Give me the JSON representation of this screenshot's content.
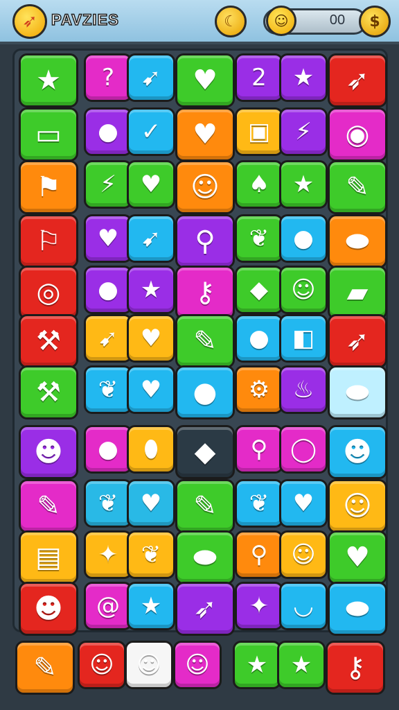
{
  "header": {
    "title": "PAVZIES",
    "score": "00",
    "icons": [
      "rocket-logo-icon",
      "banana-icon",
      "smiley-icon",
      "coin-icon"
    ]
  },
  "colors": {
    "green": "#3ecb2a",
    "magenta": "#e42bc8",
    "cyan": "#22b8f0",
    "purple": "#9a2ee6",
    "red": "#e4261f",
    "orange": "#ff8a0d",
    "yellow": "#ffb915",
    "teal": "#29b9e6",
    "lightcyan": "#bff0ff",
    "darkslate": "#2b3a45",
    "white": "#f6f6f6"
  },
  "grid": {
    "rows": [
      [
        {
          "name": "star-wand-icon",
          "glyph": "★",
          "color": "green"
        },
        {
          "name": "question-icon",
          "glyph": "?",
          "color": "magenta"
        },
        {
          "name": "boomerang-icon",
          "glyph": "➹",
          "color": "cyan"
        },
        {
          "name": "heart-icon",
          "glyph": "♥",
          "color": "green"
        },
        {
          "name": "number-two-icon",
          "glyph": "2",
          "color": "purple"
        },
        {
          "name": "star-icon",
          "glyph": "★",
          "color": "purple"
        },
        {
          "name": "rocket-icon",
          "glyph": "➶",
          "color": "red"
        }
      ],
      [
        {
          "name": "scroll-banner-icon",
          "glyph": "▭",
          "color": "green"
        },
        {
          "name": "balloon-icon",
          "glyph": "●",
          "color": "purple"
        },
        {
          "name": "chili-icon",
          "glyph": "✓",
          "color": "cyan"
        },
        {
          "name": "cloud-heart-icon",
          "glyph": "♥",
          "color": "orange"
        },
        {
          "name": "treasure-box-icon",
          "glyph": "▣",
          "color": "yellow"
        },
        {
          "name": "lightning-gem-icon",
          "glyph": "⚡",
          "color": "purple"
        },
        {
          "name": "magnifier-icon",
          "glyph": "◉",
          "color": "magenta"
        }
      ],
      [
        {
          "name": "flag-icon",
          "glyph": "⚑",
          "color": "orange"
        },
        {
          "name": "lightning-icon",
          "glyph": "⚡",
          "color": "green"
        },
        {
          "name": "heart-icon",
          "glyph": "♥",
          "color": "green"
        },
        {
          "name": "cat-face-icon",
          "glyph": "☺",
          "color": "orange"
        },
        {
          "name": "leaf-icon",
          "glyph": "♠",
          "color": "green"
        },
        {
          "name": "star-icon",
          "glyph": "★",
          "color": "green"
        },
        {
          "name": "crayon-icon",
          "glyph": "✎",
          "color": "green"
        }
      ],
      [
        {
          "name": "banner-sign-icon",
          "glyph": "⚐",
          "color": "red"
        },
        {
          "name": "heart-icon",
          "glyph": "♥",
          "color": "purple"
        },
        {
          "name": "boomerang-icon",
          "glyph": "➹",
          "color": "cyan"
        },
        {
          "name": "magnifier-icon",
          "glyph": "⚲",
          "color": "purple"
        },
        {
          "name": "leaf-icon",
          "glyph": "❦",
          "color": "green"
        },
        {
          "name": "apple-icon",
          "glyph": "●",
          "color": "cyan"
        },
        {
          "name": "bread-icon",
          "glyph": "⬬",
          "color": "orange"
        }
      ],
      [
        {
          "name": "spiral-icon",
          "glyph": "◎",
          "color": "red"
        },
        {
          "name": "bomb-icon",
          "glyph": "●",
          "color": "purple"
        },
        {
          "name": "star-icon",
          "glyph": "★",
          "color": "purple"
        },
        {
          "name": "key-icon",
          "glyph": "⚷",
          "color": "magenta"
        },
        {
          "name": "gem-icon",
          "glyph": "◆",
          "color": "green"
        },
        {
          "name": "ghost-face-icon",
          "glyph": "☺",
          "color": "green"
        },
        {
          "name": "eraser-icon",
          "glyph": "▰",
          "color": "green"
        }
      ],
      [
        {
          "name": "axe-icon",
          "glyph": "⚒",
          "color": "red"
        },
        {
          "name": "boomerang-icon",
          "glyph": "➹",
          "color": "yellow"
        },
        {
          "name": "heart-icon",
          "glyph": "♥",
          "color": "yellow"
        },
        {
          "name": "pencil-icon",
          "glyph": "✎",
          "color": "green"
        },
        {
          "name": "cookie-icon",
          "glyph": "●",
          "color": "cyan"
        },
        {
          "name": "puzzle-icon",
          "glyph": "◧",
          "color": "cyan"
        },
        {
          "name": "rocket-pop-icon",
          "glyph": "➶",
          "color": "red"
        }
      ],
      [
        {
          "name": "hammer-icon",
          "glyph": "⚒",
          "color": "green"
        },
        {
          "name": "leaf-icon",
          "glyph": "❦",
          "color": "cyan"
        },
        {
          "name": "heart-icon",
          "glyph": "♥",
          "color": "cyan"
        },
        {
          "name": "lime-icon",
          "glyph": "●",
          "color": "cyan"
        },
        {
          "name": "robot-icon",
          "glyph": "⚙",
          "color": "orange"
        },
        {
          "name": "bell-pepper-icon",
          "glyph": "♨",
          "color": "purple"
        },
        {
          "name": "pastry-icon",
          "glyph": "⬬",
          "color": "lightcyan"
        }
      ],
      [
        {
          "name": "monster-face-icon",
          "glyph": "☻",
          "color": "purple"
        },
        {
          "name": "egg-icon",
          "glyph": "●",
          "color": "magenta"
        },
        {
          "name": "bean-icon",
          "glyph": "⬮",
          "color": "yellow"
        },
        {
          "name": "crystal-icon",
          "glyph": "◆",
          "color": "darkslate"
        },
        {
          "name": "magnifier-icon",
          "glyph": "⚲",
          "color": "magenta"
        },
        {
          "name": "ring-icon",
          "glyph": "◯",
          "color": "magenta"
        },
        {
          "name": "red-face-icon",
          "glyph": "☻",
          "color": "cyan"
        }
      ],
      [
        {
          "name": "pen-paper-icon",
          "glyph": "✎",
          "color": "magenta"
        },
        {
          "name": "leaf-icon",
          "glyph": "❦",
          "color": "teal"
        },
        {
          "name": "heart-icon",
          "glyph": "♥",
          "color": "teal"
        },
        {
          "name": "pencil-icon",
          "glyph": "✎",
          "color": "green"
        },
        {
          "name": "leaf-icon",
          "glyph": "❦",
          "color": "cyan"
        },
        {
          "name": "heart-icon",
          "glyph": "♥",
          "color": "cyan"
        },
        {
          "name": "tiger-face-icon",
          "glyph": "☺",
          "color": "yellow"
        }
      ],
      [
        {
          "name": "scroll-robot-icon",
          "glyph": "▤",
          "color": "yellow"
        },
        {
          "name": "star-icon",
          "glyph": "✦",
          "color": "yellow"
        },
        {
          "name": "leaf-icon",
          "glyph": "❦",
          "color": "yellow"
        },
        {
          "name": "lemon-icon",
          "glyph": "⬬",
          "color": "green"
        },
        {
          "name": "magnifier-icon",
          "glyph": "⚲",
          "color": "orange"
        },
        {
          "name": "smile-face-icon",
          "glyph": "☺",
          "color": "yellow"
        },
        {
          "name": "heart-icon",
          "glyph": "♥",
          "color": "green"
        }
      ],
      [
        {
          "name": "pink-monster-icon",
          "glyph": "☻",
          "color": "red"
        },
        {
          "name": "snail-icon",
          "glyph": "@",
          "color": "magenta"
        },
        {
          "name": "star-icon",
          "glyph": "★",
          "color": "cyan"
        },
        {
          "name": "firework-icon",
          "glyph": "➶",
          "color": "purple"
        },
        {
          "name": "star-icon",
          "glyph": "✦",
          "color": "purple"
        },
        {
          "name": "bowl-icon",
          "glyph": "◡",
          "color": "cyan"
        },
        {
          "name": "bread-icon",
          "glyph": "⬬",
          "color": "cyan"
        }
      ]
    ]
  },
  "bottom": [
    {
      "name": "paintbrush-icon",
      "glyph": "✎",
      "color": "orange"
    },
    {
      "name": "ghost-face-icon",
      "glyph": "☺",
      "color": "red"
    },
    {
      "name": "bear-face-icon",
      "glyph": "☺",
      "color": "white"
    },
    {
      "name": "cat-face-icon",
      "glyph": "☺",
      "color": "magenta"
    },
    {
      "name": "star-icon",
      "glyph": "★",
      "color": "green"
    },
    {
      "name": "star-icon",
      "glyph": "★",
      "color": "green"
    },
    {
      "name": "key-heart-icon",
      "glyph": "⚷",
      "color": "red"
    }
  ]
}
